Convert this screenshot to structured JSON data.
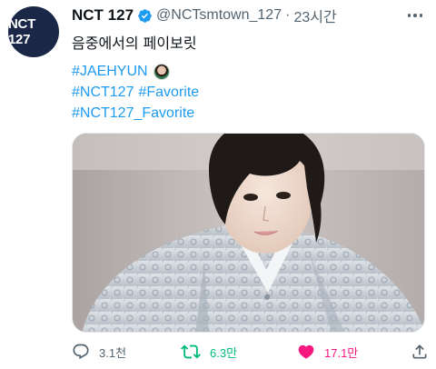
{
  "account": {
    "avatar_text": "NCT 127",
    "name": "NCT 127",
    "handle": "@NCTsmtown_127",
    "separator": "·",
    "time": "23시간"
  },
  "tweet": {
    "text": "음중에서의 페이보릿",
    "hashtags": {
      "line1": "#JAEHYUN",
      "line2a": "#NCT127",
      "line2b": "#Favorite",
      "line3": "#NCT127_Favorite"
    }
  },
  "actions": {
    "reply_count": "3.1천",
    "retweet_count": "6.3만",
    "like_count": "17.1만"
  },
  "colors": {
    "link": "#1d9bf0",
    "retweet": "#00ba7c",
    "like": "#f91880",
    "muted": "#536471",
    "avatar_bg": "#1a2746"
  },
  "icons": [
    "verified-badge-icon",
    "more-icon",
    "reply-icon",
    "retweet-icon",
    "heart-icon",
    "share-icon"
  ]
}
